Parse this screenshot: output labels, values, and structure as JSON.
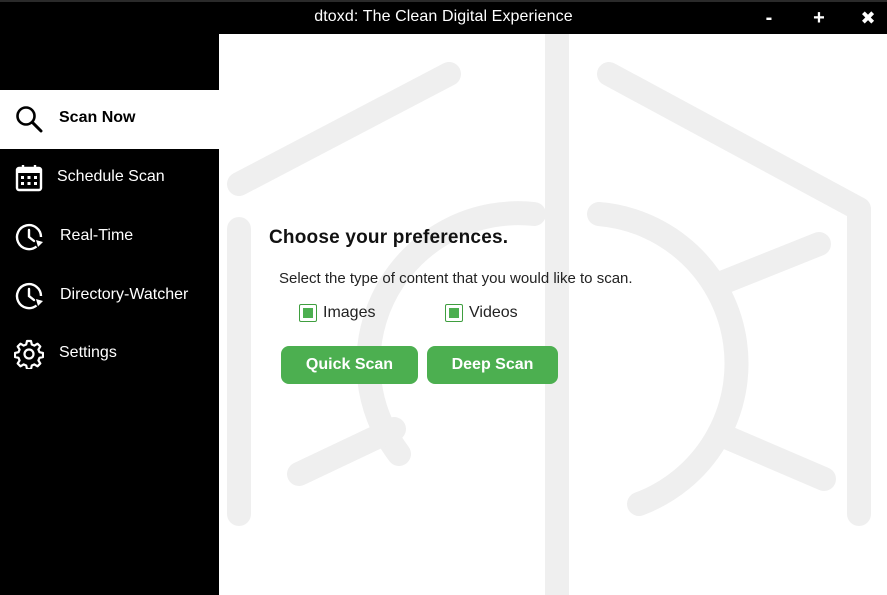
{
  "window": {
    "title": "dtoxd: The Clean Digital Experience",
    "minimize_label": "-",
    "maximize_label": "+",
    "close_label": "✖"
  },
  "sidebar": {
    "items": [
      {
        "label": "Scan Now",
        "icon": "search-icon",
        "active": true
      },
      {
        "label": "Schedule Scan",
        "icon": "calendar-icon",
        "active": false
      },
      {
        "label": "Real-Time",
        "icon": "clock-history-icon",
        "active": false
      },
      {
        "label": "Directory-Watcher",
        "icon": "clock-history-icon",
        "active": false
      },
      {
        "label": "Settings",
        "icon": "gear-icon",
        "active": false
      }
    ]
  },
  "main": {
    "heading": "Choose your preferences.",
    "subtitle": "Select the type of content that you would like to scan.",
    "options": [
      {
        "label": "Images",
        "checked": true
      },
      {
        "label": "Videos",
        "checked": true
      }
    ],
    "buttons": {
      "quick_scan": "Quick Scan",
      "deep_scan": "Deep Scan"
    }
  },
  "colors": {
    "accent": "#4caf50",
    "sidebar_bg": "#000000",
    "titlebar_bg": "#000000",
    "watermark": "#efefef"
  }
}
